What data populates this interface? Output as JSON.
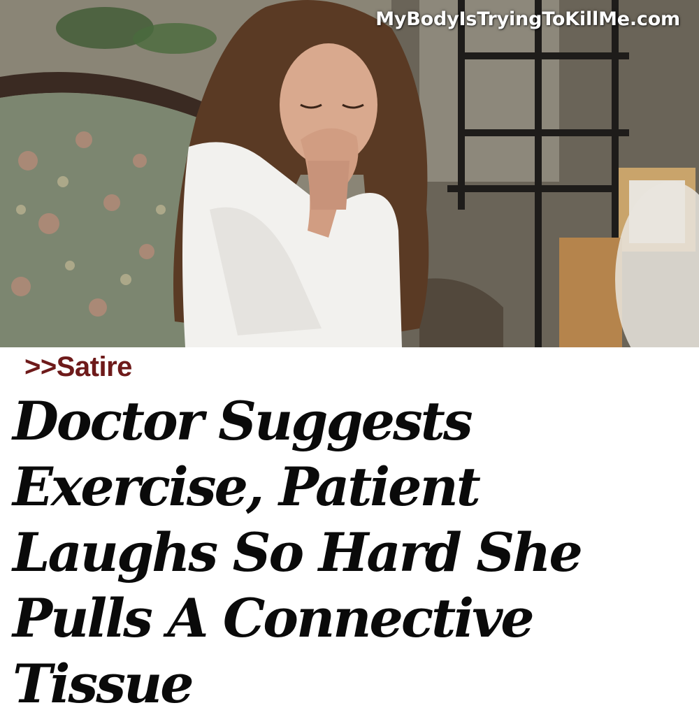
{
  "photo": {
    "watermark": "MyBodyIsTryingToKillMe.com",
    "subject_icon": "distressed-woman-photo"
  },
  "article": {
    "category_tag": ">>Satire",
    "headline": "Doctor Suggests Exercise, Patient Laughs So Hard She Pulls A Connective Tissue"
  },
  "colors": {
    "tag": "#6e1a1a",
    "headline": "#0a0a0a",
    "background": "#ffffff"
  }
}
